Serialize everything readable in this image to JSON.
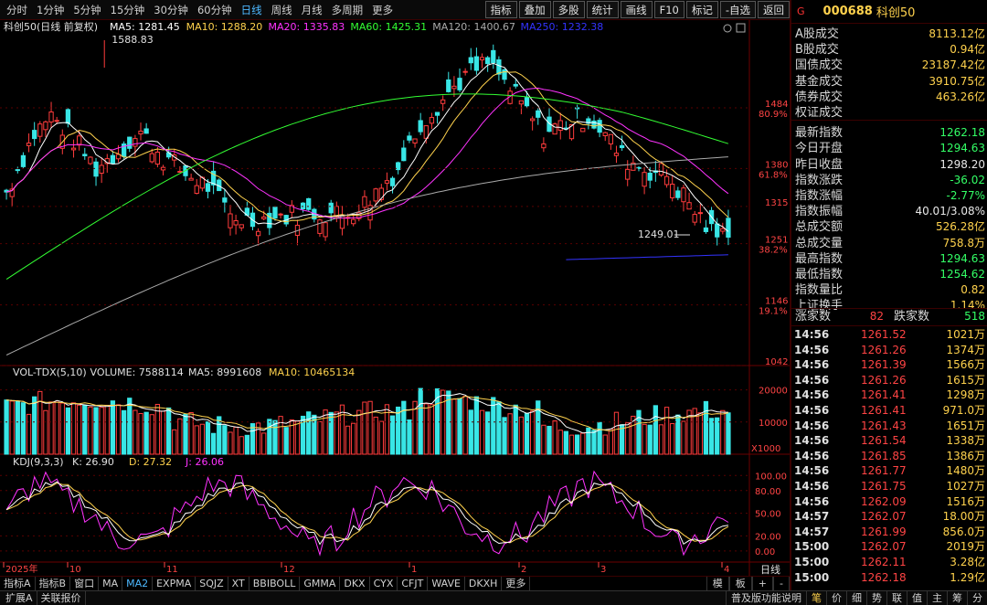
{
  "toolbar": {
    "periods": [
      "分时",
      "1分钟",
      "5分钟",
      "15分钟",
      "30分钟",
      "60分钟",
      "日线",
      "周线",
      "月线",
      "多周期",
      "更多"
    ],
    "active_period": "日线",
    "buttons": [
      "指标",
      "叠加",
      "多股",
      "统计",
      "画线",
      "F10",
      "标记",
      "-自选",
      "返回"
    ]
  },
  "chart": {
    "title": "科创50(日线 前复权)",
    "ma_legend": [
      {
        "label": "MA5: 1281.45",
        "color": "#ffffff"
      },
      {
        "label": "MA10: 1288.20",
        "color": "#ffd24d"
      },
      {
        "label": "MA20: 1335.83",
        "color": "#ff33ff"
      },
      {
        "label": "MA60: 1425.31",
        "color": "#33ff33"
      },
      {
        "label": "MA120: 1400.67",
        "color": "#aaaaaa"
      },
      {
        "label": "MA250: 1232.38",
        "color": "#3333ff"
      }
    ],
    "high_label": "1588.83",
    "low_label": "1249.01",
    "price_axis": [
      {
        "label": "1484",
        "pct": "80.9%"
      },
      {
        "label": "1380",
        "pct": "61.8%"
      },
      {
        "label": "1315",
        "pct": ""
      },
      {
        "label": "1251",
        "pct": "38.2%"
      },
      {
        "label": "1146",
        "pct": "19.1%"
      },
      {
        "label": "1042",
        "pct": ""
      }
    ],
    "vol_legend": {
      "name": "VOL-TDX(5,10)",
      "volume": "VOLUME: 7588114",
      "ma5": "MA5: 8991608",
      "ma10": "MA10: 10465134"
    },
    "vol_axis": [
      "20000",
      "10000"
    ],
    "vol_unit": "X1000",
    "kdj_legend": {
      "name": "KDJ(9,3,3)",
      "k": "K: 26.90",
      "d": "D: 27.32",
      "j": "J: 26.06"
    },
    "kdj_axis": [
      "100.00",
      "80.00",
      "50.00",
      "20.00",
      "0.00"
    ],
    "date_axis": [
      "2025年",
      "10",
      "11",
      "12",
      "1",
      "2",
      "3",
      "4"
    ],
    "date_axis_right": "日线"
  },
  "chart_data": {
    "type": "candlestick",
    "title": "科创50(日线 前复权)",
    "ylim": [
      1042,
      1600
    ],
    "high": 1588.83,
    "low": 1249.01,
    "last_close": 1262.18,
    "moving_averages": {
      "MA5": 1281.45,
      "MA10": 1288.2,
      "MA20": 1335.83,
      "MA60": 1425.31,
      "MA120": 1400.67,
      "MA250": 1232.38
    },
    "volume": {
      "VOLUME": 7588114,
      "MA5": 8991608,
      "MA10": 10465134
    },
    "kdj": {
      "K": 26.9,
      "D": 27.32,
      "J": 26.06
    }
  },
  "bottom_tabs": [
    "指标A",
    "指标B",
    "窗口",
    "MA",
    "MA2",
    "EXPMA",
    "SQJZ",
    "XT",
    "BBIBOLL",
    "GMMA",
    "DKX",
    "CYX",
    "CFJT",
    "WAVE",
    "DKXH",
    "更多"
  ],
  "bottom_tabs_active": "MA2",
  "bottom_right": [
    "模",
    "板",
    "+",
    "-"
  ],
  "status_left": [
    "扩展A",
    "关联报价"
  ],
  "status_right": [
    "普及版功能说明",
    "笔",
    "价",
    "细",
    "势",
    "联",
    "值",
    "主",
    "筹",
    "分"
  ],
  "status_active": "笔",
  "panel": {
    "tag": "G",
    "code": "000688",
    "name": "科创50",
    "stats": [
      {
        "label": "A股成交",
        "value": "8113.12亿",
        "color": "#ffd24d"
      },
      {
        "label": "B股成交",
        "value": "0.94亿",
        "color": "#ffd24d"
      },
      {
        "label": "国债成交",
        "value": "23187.42亿",
        "color": "#ffd24d"
      },
      {
        "label": "基金成交",
        "value": "3910.75亿",
        "color": "#ffd24d"
      },
      {
        "label": "债券成交",
        "value": "463.26亿",
        "color": "#ffd24d"
      },
      {
        "label": "权证成交",
        "value": "",
        "color": "#ffd24d"
      },
      {
        "label": "最新指数",
        "value": "1262.18",
        "color": "#33ff66"
      },
      {
        "label": "今日开盘",
        "value": "1294.63",
        "color": "#33ff66"
      },
      {
        "label": "昨日收盘",
        "value": "1298.20",
        "color": "#e8e8e8"
      },
      {
        "label": "指数涨跌",
        "value": "-36.02",
        "color": "#33ff66"
      },
      {
        "label": "指数涨幅",
        "value": "-2.77%",
        "color": "#33ff66"
      },
      {
        "label": "指数振幅",
        "value": "40.01/3.08%",
        "color": "#e8e8e8"
      },
      {
        "label": "总成交额",
        "value": "526.28亿",
        "color": "#ffd24d"
      },
      {
        "label": "总成交量",
        "value": "758.8万",
        "color": "#ffd24d"
      },
      {
        "label": "最高指数",
        "value": "1294.63",
        "color": "#33ff66"
      },
      {
        "label": "最低指数",
        "value": "1254.62",
        "color": "#33ff66"
      },
      {
        "label": "指数量比",
        "value": "0.82",
        "color": "#ffd24d"
      },
      {
        "label": "上证换手",
        "value": "1.14%",
        "color": "#ffd24d"
      }
    ],
    "up_label": "涨家数",
    "up_value": "82",
    "down_label": "跌家数",
    "down_value": "518",
    "ticks": [
      {
        "t": "14:56",
        "p": "1261.52",
        "v": "1021万"
      },
      {
        "t": "14:56",
        "p": "1261.26",
        "v": "1374万"
      },
      {
        "t": "14:56",
        "p": "1261.39",
        "v": "1566万"
      },
      {
        "t": "14:56",
        "p": "1261.26",
        "v": "1615万"
      },
      {
        "t": "14:56",
        "p": "1261.41",
        "v": "1298万"
      },
      {
        "t": "14:56",
        "p": "1261.41",
        "v": "971.0万"
      },
      {
        "t": "14:56",
        "p": "1261.43",
        "v": "1651万"
      },
      {
        "t": "14:56",
        "p": "1261.54",
        "v": "1338万"
      },
      {
        "t": "14:56",
        "p": "1261.85",
        "v": "1386万"
      },
      {
        "t": "14:56",
        "p": "1261.77",
        "v": "1480万"
      },
      {
        "t": "14:56",
        "p": "1261.75",
        "v": "1027万"
      },
      {
        "t": "14:56",
        "p": "1262.09",
        "v": "1516万"
      },
      {
        "t": "14:57",
        "p": "1262.07",
        "v": "18.00万"
      },
      {
        "t": "14:57",
        "p": "1261.99",
        "v": "856.0万"
      },
      {
        "t": "15:00",
        "p": "1262.07",
        "v": "2019万"
      },
      {
        "t": "15:00",
        "p": "1262.11",
        "v": "3.28亿"
      },
      {
        "t": "15:00",
        "p": "1262.18",
        "v": "1.29亿"
      }
    ]
  }
}
